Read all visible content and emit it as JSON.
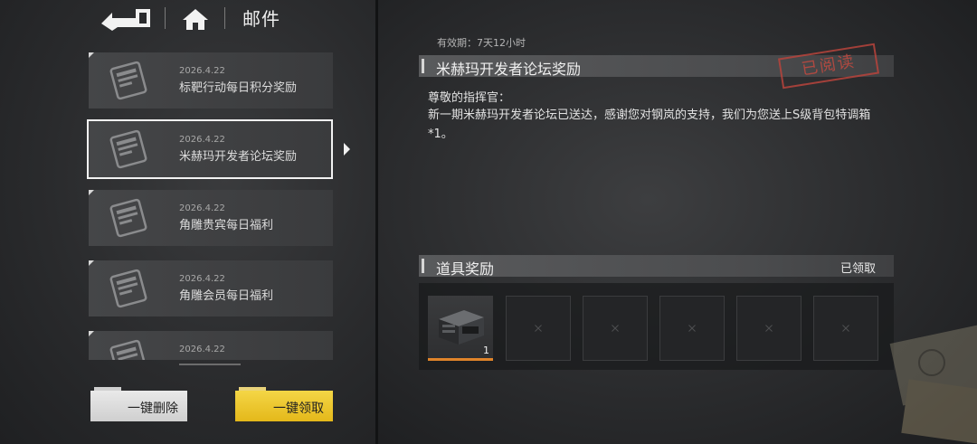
{
  "header": {
    "title": "邮件",
    "back_icon": "back-arrow-icon",
    "home_icon": "home-icon"
  },
  "mail_list": [
    {
      "date": "2026.4.22",
      "title": "标靶行动每日积分奖励",
      "selected": false
    },
    {
      "date": "2026.4.22",
      "title": "米赫玛开发者论坛奖励",
      "selected": true
    },
    {
      "date": "2026.4.22",
      "title": "角雕贵宾每日福利",
      "selected": false
    },
    {
      "date": "2026.4.22",
      "title": "角雕会员每日福利",
      "selected": false
    },
    {
      "date": "2026.4.22",
      "title": "",
      "selected": false
    }
  ],
  "buttons": {
    "delete_all": "一键删除",
    "claim_all": "一键领取"
  },
  "detail": {
    "validity": "有效期：7天12小时",
    "title": "米赫玛开发者论坛奖励",
    "stamp": "已阅读",
    "salutation": "尊敬的指挥官：",
    "body": "新一期米赫玛开发者论坛已送达，感谢您对钢岚的支持，我们为您送上S级背包特调箱*1。"
  },
  "rewards": {
    "title": "道具奖励",
    "status": "已领取",
    "items": [
      {
        "name": "S级背包特调箱",
        "qty": "1",
        "icon": "crate-icon"
      }
    ],
    "empty_slots": 5
  },
  "colors": {
    "accent_yellow": "#e9c21f",
    "stamp_red": "#c24a40",
    "rarity_orange": "#e0842a"
  }
}
